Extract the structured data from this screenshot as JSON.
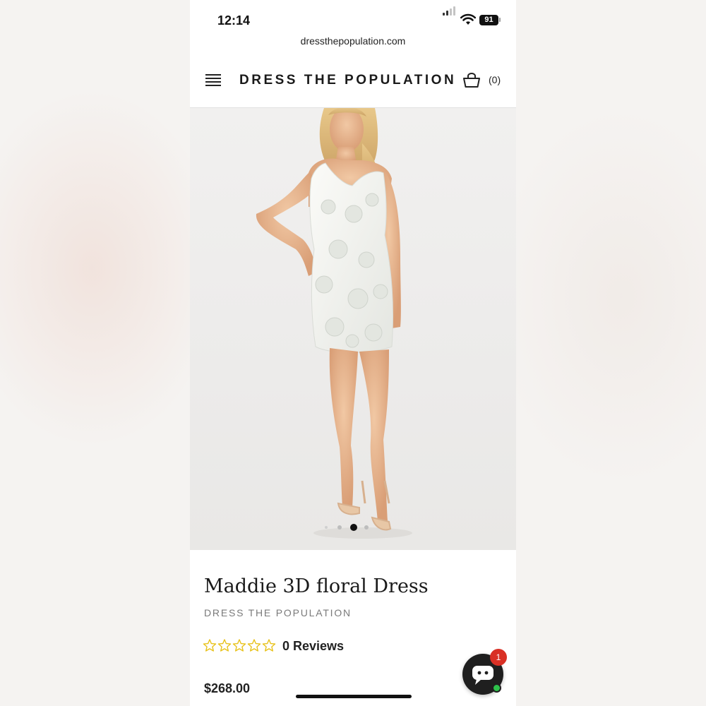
{
  "status_bar": {
    "time": "12:14",
    "battery": "91",
    "url": "dressthepopulation.com"
  },
  "header": {
    "brand": "DRESS THE POPULATION",
    "cart_count": "(0)",
    "menu_icon": "hamburger-menu-icon",
    "cart_icon": "shopping-basket-icon"
  },
  "product": {
    "image_description_icon": "product-photo",
    "carousel": {
      "total": 4,
      "active_index": 2
    },
    "title": "Maddie 3D floral Dress",
    "vendor": "DRESS THE POPULATION",
    "rating": {
      "value": 0,
      "max": 5
    },
    "reviews": "0 Reviews",
    "price": "$268.00"
  },
  "chat": {
    "badge": "1",
    "icon": "chat-bubble-icon"
  },
  "colors": {
    "star": "#e8c21a",
    "badge": "#d93025",
    "online": "#2ec24b"
  }
}
